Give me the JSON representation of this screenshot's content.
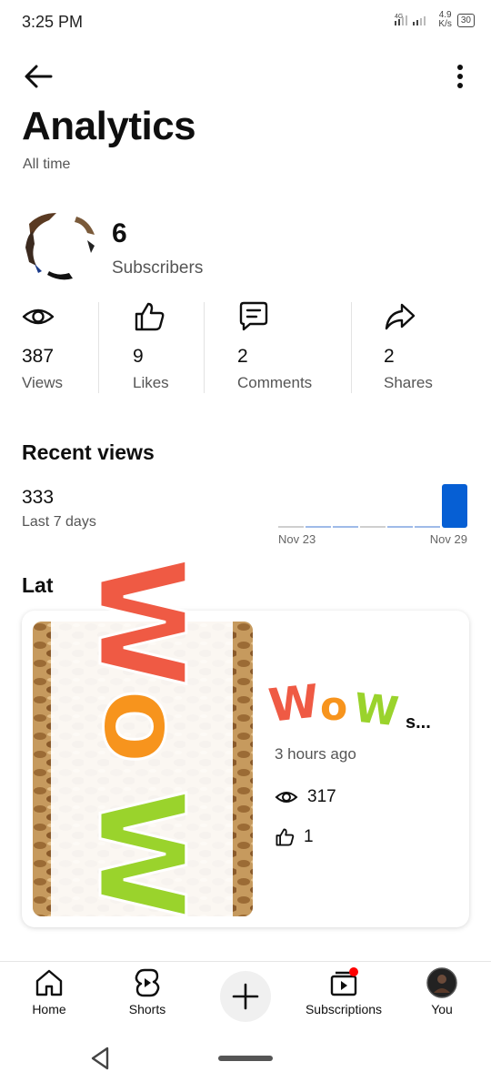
{
  "status": {
    "time": "3:25 PM",
    "network": "4G",
    "speed_value": "4.9",
    "speed_unit": "K/s",
    "battery": "30"
  },
  "header": {
    "title": "Analytics",
    "subtitle": "All time"
  },
  "channel": {
    "subscribers_count": "6",
    "subscribers_label": "Subscribers"
  },
  "stats": [
    {
      "value": "387",
      "label": "Views",
      "icon": "eye-icon"
    },
    {
      "value": "9",
      "label": "Likes",
      "icon": "thumbs-up-icon"
    },
    {
      "value": "2",
      "label": "Comments",
      "icon": "comment-icon"
    },
    {
      "value": "2",
      "label": "Shares",
      "icon": "share-icon"
    }
  ],
  "recent_views": {
    "title": "Recent views",
    "value": "333",
    "period": "Last 7 days",
    "start_label": "Nov 23",
    "end_label": "Nov 29",
    "daily": [
      0,
      0,
      0,
      0,
      0,
      0,
      333
    ]
  },
  "latest": {
    "title": "Lat",
    "video": {
      "title_suffix": "s...",
      "time": "3 hours ago",
      "views": "317",
      "likes": "1"
    }
  },
  "nav": {
    "home": "Home",
    "shorts": "Shorts",
    "subscriptions": "Subscriptions",
    "you": "You"
  },
  "colors": {
    "accent": "#065fd4",
    "notification": "#ff0000",
    "wow_green": "#9ad32c",
    "wow_orange": "#f7941d",
    "wow_red": "#ef5a44"
  }
}
